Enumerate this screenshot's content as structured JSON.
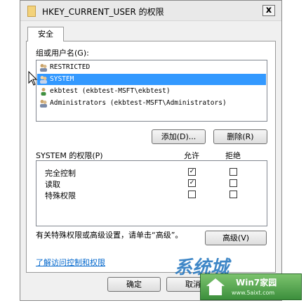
{
  "window": {
    "title": "HKEY_CURRENT_USER 的权限",
    "close_label": "x"
  },
  "tabs": [
    {
      "label": "安全"
    }
  ],
  "groups": {
    "label": "组或用户名(G):",
    "items": [
      {
        "label": "RESTRICTED",
        "selected": false
      },
      {
        "label": "SYSTEM",
        "selected": true
      },
      {
        "label": "ekbtest (ekbtest-MSFT\\ekbtest)",
        "selected": false
      },
      {
        "label": "Administrators (ekbtest-MSFT\\Administrators)",
        "selected": false
      }
    ]
  },
  "buttons": {
    "add": "添加(D)...",
    "remove": "删除(R)",
    "advanced": "高级(V)",
    "ok": "确定",
    "cancel": "取消"
  },
  "permissions": {
    "header_label": "SYSTEM 的权限(P)",
    "allow_header": "允许",
    "deny_header": "拒绝",
    "rows": [
      {
        "name": "完全控制",
        "allow": true,
        "deny": false
      },
      {
        "name": "读取",
        "allow": true,
        "deny": false
      },
      {
        "name": "特殊权限",
        "allow": false,
        "deny": false
      }
    ]
  },
  "advanced_note": "有关特殊权限或高级设置，请单击“高级”。",
  "help_link": "了解访问控制和权限",
  "watermark": {
    "text": "系统城",
    "badge_title": "Win7家园",
    "badge_url": "www.5aixt.com"
  },
  "colors": {
    "selection": "#3399ff",
    "link": "#0066cc"
  }
}
